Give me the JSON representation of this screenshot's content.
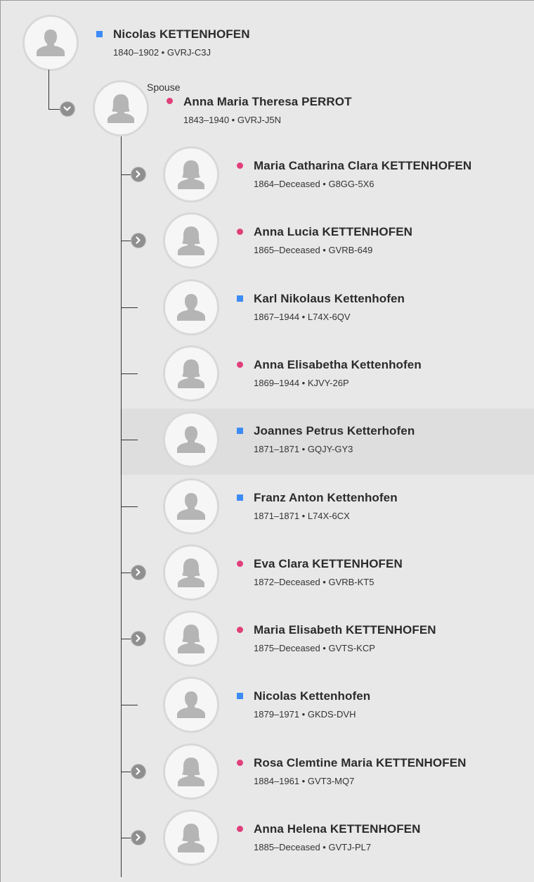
{
  "root": {
    "name": "Nicolas KETTENHOFEN",
    "info": "1840–1902 • GVRJ-C3J",
    "gender": "male"
  },
  "spouse": {
    "label": "Spouse",
    "name": "Anna Maria Theresa PERROT",
    "info": "1843–1940 • GVRJ-J5N",
    "gender": "female",
    "expanded": true
  },
  "children": [
    {
      "name": "Maria Catharina Clara KETTENHOFEN",
      "info": "1864–Deceased • G8GG-5X6",
      "gender": "female",
      "has_expand": true
    },
    {
      "name": "Anna Lucia KETTENHOFEN",
      "info": "1865–Deceased • GVRB-649",
      "gender": "female",
      "has_expand": true
    },
    {
      "name": "Karl Nikolaus Kettenhofen",
      "info": "1867–1944 • L74X-6QV",
      "gender": "male",
      "has_expand": false
    },
    {
      "name": "Anna Elisabetha Kettenhofen",
      "info": "1869–1944 • KJVY-26P",
      "gender": "female",
      "has_expand": false
    },
    {
      "name": "Joannes Petrus Ketterhofen",
      "info": "1871–1871 • GQJY-GY3",
      "gender": "male",
      "has_expand": false,
      "highlighted": true
    },
    {
      "name": "Franz Anton Kettenhofen",
      "info": "1871–1871 • L74X-6CX",
      "gender": "male",
      "has_expand": false
    },
    {
      "name": "Eva Clara KETTENHOFEN",
      "info": "1872–Deceased • GVRB-KT5",
      "gender": "female",
      "has_expand": true
    },
    {
      "name": "Maria Elisabeth KETTENHOFEN",
      "info": "1875–Deceased • GVTS-KCP",
      "gender": "female",
      "has_expand": true
    },
    {
      "name": "Nicolas Kettenhofen",
      "info": "1879–1971 • GKDS-DVH",
      "gender": "male",
      "has_expand": false
    },
    {
      "name": "Rosa Clemtine Maria KETTENHOFEN",
      "info": "1884–1961 • GVT3-MQ7",
      "gender": "female",
      "has_expand": true
    },
    {
      "name": "Anna Helena KETTENHOFEN",
      "info": "1885–Deceased • GVTJ-PL7",
      "gender": "female",
      "has_expand": true
    }
  ],
  "icons": {
    "male_avatar": "male-silhouette-icon",
    "female_avatar": "female-silhouette-icon",
    "expand": "chevron-right-icon",
    "collapse": "chevron-down-icon"
  },
  "colors": {
    "male": "#3d8bf5",
    "female": "#e0407a",
    "background": "#e8e8e8",
    "highlight": "#dedede"
  }
}
